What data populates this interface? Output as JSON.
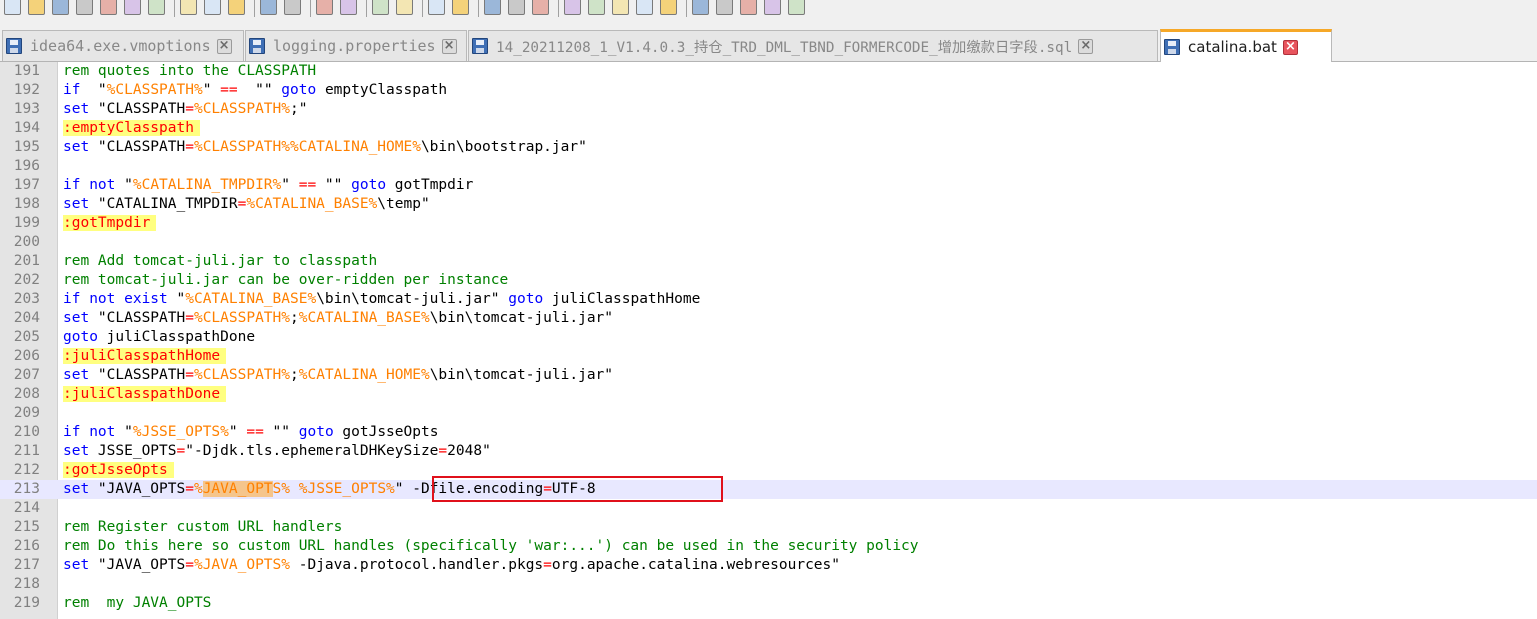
{
  "toolbar": {
    "icons": [
      "new-file-icon",
      "open-file-icon",
      "save-icon",
      "save-all-icon",
      "close-icon",
      "close-all-icon",
      "print-icon",
      "cut-icon",
      "copy-icon",
      "paste-icon",
      "undo-icon",
      "redo-icon",
      "find-icon",
      "replace-icon",
      "zoom-in-icon",
      "zoom-out-icon",
      "sync-vertical-icon",
      "sync-horizontal-icon",
      "word-wrap-icon",
      "show-all-chars-icon",
      "indent-guide-icon",
      "user-language-icon",
      "document-map-icon",
      "function-list-icon",
      "folder-workspace-icon",
      "monitoring-icon",
      "record-macro-icon",
      "stop-macro-icon",
      "play-macro-icon",
      "run-macro-multiple-icon",
      "save-macro-icon"
    ]
  },
  "tabs": [
    {
      "label": "idea64.exe.vmoptions",
      "active": false
    },
    {
      "label": "logging.properties",
      "active": false
    },
    {
      "label": "14_20211208_1_V1.4.0.3_持仓_TRD_DML_TBND_FORMERCODE_增加缴款日字段.sql",
      "active": false
    },
    {
      "label": "catalina.bat",
      "active": true
    }
  ],
  "editor": {
    "current_line": 213,
    "lines": [
      {
        "n": "191",
        "t": [
          [
            "cm",
            "rem quotes into the CLASSPATH"
          ]
        ]
      },
      {
        "n": "192",
        "t": [
          [
            "kw",
            "if"
          ],
          [
            "",
            "  \""
          ],
          [
            "var",
            "%CLASSPATH%"
          ],
          [
            "",
            "\" "
          ],
          [
            "op",
            "=="
          ],
          [
            "",
            "  \"\" "
          ],
          [
            "kw",
            "goto"
          ],
          [
            "",
            " emptyClasspath"
          ]
        ]
      },
      {
        "n": "193",
        "t": [
          [
            "kw",
            "set"
          ],
          [
            "",
            " \"CLASSPATH"
          ],
          [
            "op",
            "="
          ],
          [
            "var",
            "%CLASSPATH%"
          ],
          [
            "",
            ";\""
          ]
        ]
      },
      {
        "n": "194",
        "t": [
          [
            "lbl",
            ":emptyClasspath"
          ]
        ]
      },
      {
        "n": "195",
        "t": [
          [
            "kw",
            "set"
          ],
          [
            "",
            " \"CLASSPATH"
          ],
          [
            "op",
            "="
          ],
          [
            "var",
            "%CLASSPATH%%CATALINA_HOME%"
          ],
          [
            "",
            "\\bin\\bootstrap.jar\""
          ]
        ]
      },
      {
        "n": "196",
        "t": []
      },
      {
        "n": "197",
        "t": [
          [
            "kw",
            "if not"
          ],
          [
            "",
            " \""
          ],
          [
            "var",
            "%CATALINA_TMPDIR%"
          ],
          [
            "",
            "\" "
          ],
          [
            "op",
            "=="
          ],
          [
            "",
            " \"\" "
          ],
          [
            "kw",
            "goto"
          ],
          [
            "",
            " gotTmpdir"
          ]
        ]
      },
      {
        "n": "198",
        "t": [
          [
            "kw",
            "set"
          ],
          [
            "",
            " \"CATALINA_TMPDIR"
          ],
          [
            "op",
            "="
          ],
          [
            "var",
            "%CATALINA_BASE%"
          ],
          [
            "",
            "\\temp\""
          ]
        ]
      },
      {
        "n": "199",
        "t": [
          [
            "lbl",
            ":gotTmpdir"
          ]
        ]
      },
      {
        "n": "200",
        "t": []
      },
      {
        "n": "201",
        "t": [
          [
            "cm",
            "rem Add tomcat-juli.jar to classpath"
          ]
        ]
      },
      {
        "n": "202",
        "t": [
          [
            "cm",
            "rem tomcat-juli.jar can be over-ridden per instance"
          ]
        ]
      },
      {
        "n": "203",
        "t": [
          [
            "kw",
            "if not exist"
          ],
          [
            "",
            " \""
          ],
          [
            "var",
            "%CATALINA_BASE%"
          ],
          [
            "",
            "\\bin\\tomcat-juli.jar\" "
          ],
          [
            "kw",
            "goto"
          ],
          [
            "",
            " juliClasspathHome"
          ]
        ]
      },
      {
        "n": "204",
        "t": [
          [
            "kw",
            "set"
          ],
          [
            "",
            " \"CLASSPATH"
          ],
          [
            "op",
            "="
          ],
          [
            "var",
            "%CLASSPATH%"
          ],
          [
            "",
            ";"
          ],
          [
            "var",
            "%CATALINA_BASE%"
          ],
          [
            "",
            "\\bin\\tomcat-juli.jar\""
          ]
        ]
      },
      {
        "n": "205",
        "t": [
          [
            "kw",
            "goto"
          ],
          [
            "",
            " juliClasspathDone"
          ]
        ]
      },
      {
        "n": "206",
        "t": [
          [
            "lbl",
            ":juliClasspathHome"
          ]
        ]
      },
      {
        "n": "207",
        "t": [
          [
            "kw",
            "set"
          ],
          [
            "",
            " \"CLASSPATH"
          ],
          [
            "op",
            "="
          ],
          [
            "var",
            "%CLASSPATH%"
          ],
          [
            "",
            ";"
          ],
          [
            "var",
            "%CATALINA_HOME%"
          ],
          [
            "",
            "\\bin\\tomcat-juli.jar\""
          ]
        ]
      },
      {
        "n": "208",
        "t": [
          [
            "lbl",
            ":juliClasspathDone"
          ]
        ]
      },
      {
        "n": "209",
        "t": []
      },
      {
        "n": "210",
        "t": [
          [
            "kw",
            "if not"
          ],
          [
            "",
            " \""
          ],
          [
            "var",
            "%JSSE_OPTS%"
          ],
          [
            "",
            "\" "
          ],
          [
            "op",
            "=="
          ],
          [
            "",
            " \"\" "
          ],
          [
            "kw",
            "goto"
          ],
          [
            "",
            " gotJsseOpts"
          ]
        ]
      },
      {
        "n": "211",
        "t": [
          [
            "kw",
            "set"
          ],
          [
            "",
            " JSSE_OPTS"
          ],
          [
            "op",
            "="
          ],
          [
            "",
            "\"-Djdk.tls.ephemeralDHKeySize"
          ],
          [
            "op",
            "="
          ],
          [
            "",
            "2048\""
          ]
        ]
      },
      {
        "n": "212",
        "t": [
          [
            "lbl",
            ":gotJsseOpts"
          ]
        ]
      },
      {
        "n": "213",
        "t": [
          [
            "kw",
            "set"
          ],
          [
            "",
            " \"JAVA_OPTS"
          ],
          [
            "op",
            "="
          ],
          [
            "var",
            "%"
          ],
          [
            "var sel",
            "JAVA_OPT"
          ],
          [
            "var",
            "S%"
          ],
          [
            "",
            " "
          ],
          [
            "var",
            "%JSSE_OPTS%"
          ],
          [
            "",
            "\" -Dfile.encoding"
          ],
          [
            "op",
            "="
          ],
          [
            "",
            "UTF-8"
          ]
        ]
      },
      {
        "n": "214",
        "t": []
      },
      {
        "n": "215",
        "t": [
          [
            "cm",
            "rem Register custom URL handlers"
          ]
        ]
      },
      {
        "n": "216",
        "t": [
          [
            "cm",
            "rem Do this here so custom URL handles (specifically 'war:...') can be used in the security policy"
          ]
        ]
      },
      {
        "n": "217",
        "t": [
          [
            "kw",
            "set"
          ],
          [
            "",
            " \"JAVA_OPTS"
          ],
          [
            "op",
            "="
          ],
          [
            "var",
            "%JAVA_OPTS%"
          ],
          [
            "",
            " -Djava.protocol.handler.pkgs"
          ],
          [
            "op",
            "="
          ],
          [
            "",
            "org.apache.catalina.webresources\""
          ]
        ]
      },
      {
        "n": "218",
        "t": []
      },
      {
        "n": "219",
        "t": [
          [
            "cm",
            "rem  my JAVA_OPTS"
          ]
        ]
      }
    ]
  },
  "colors": {
    "keyword": "#0000ff",
    "comment": "#008000",
    "variable": "#ff8000",
    "operator": "#ff0000",
    "label_bg": "#ffff80",
    "current_line": "#e8e8ff",
    "annotation_box": "#e0101b",
    "tab_accent": "#f6a828"
  }
}
